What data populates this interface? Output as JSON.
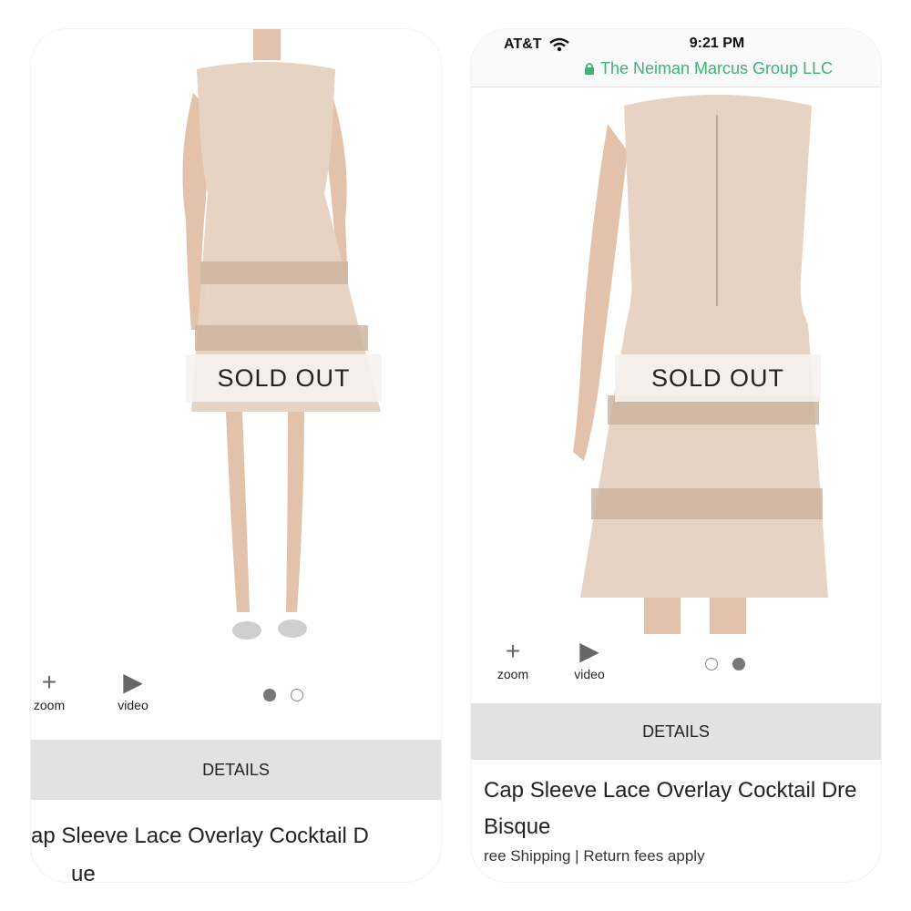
{
  "status_bar": {
    "carrier": "AT&T",
    "time": "9:21 PM",
    "site": "The Neiman Marcus Group LLC",
    "site_color": "#3cb371"
  },
  "overlay": {
    "sold_out": "SOLD OUT"
  },
  "tools": {
    "zoom_label": "zoom",
    "video_label": "video",
    "zoom_icon": "plus-icon",
    "video_icon": "play-icon"
  },
  "carousel": {
    "count": 2,
    "left_active": 1,
    "right_active": 2
  },
  "details": {
    "label": "DETAILS"
  },
  "product": {
    "title_left_visible": "ap Sleeve Lace Overlay Cocktail D",
    "color_left_visible": "ue",
    "title_right_visible": "Cap Sleeve Lace Overlay Cocktail Dre",
    "color_right": "Bisque",
    "shipping_right_visible": "ree Shipping | Return fees apply"
  },
  "colors": {
    "dress": "#e6d3c2",
    "lace": "#cbb29c",
    "skin": "#e3c2ac"
  }
}
